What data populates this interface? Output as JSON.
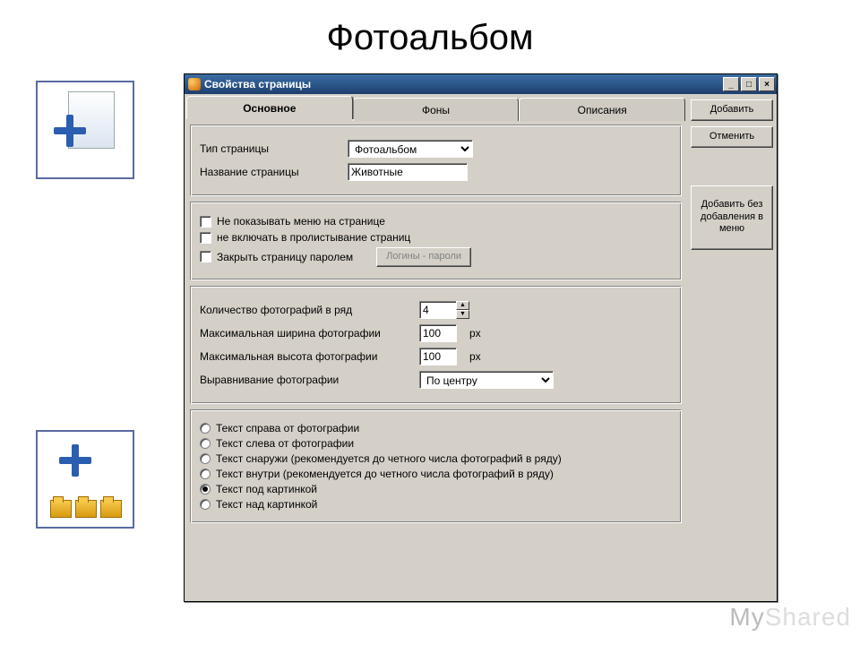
{
  "pageTitle": "Фотоальбом",
  "watermark": {
    "a": "My",
    "b": "Shared"
  },
  "window": {
    "title": "Свойства страницы",
    "tabs": [
      "Основное",
      "Фоны",
      "Описания"
    ],
    "activeTab": 0,
    "sideButtons": {
      "add": "Добавить",
      "cancel": "Отменить",
      "addNoMenu": "Добавить без добавления в меню"
    },
    "basic": {
      "pageTypeLabel": "Тип страницы",
      "pageTypeValue": "Фотоальбом",
      "pageNameLabel": "Название страницы",
      "pageNameValue": "Животные"
    },
    "options": {
      "hideMenu": "Не показывать меню на странице",
      "excludePaging": "не включать в пролистывание страниц",
      "lockPassword": "Закрыть страницу паролем",
      "loginsButton": "Логины - пароли"
    },
    "photo": {
      "perRowLabel": "Количество фотографий в ряд",
      "perRowValue": "4",
      "maxWidthLabel": "Максимальная ширина фотографии",
      "maxWidthValue": "100",
      "maxHeightLabel": "Максимальная высота фотографии",
      "maxHeightValue": "100",
      "pxUnit": "px",
      "alignLabel": "Выравнивание фотографии",
      "alignValue": "По центру"
    },
    "textPos": {
      "options": [
        "Текст справа от фотографии",
        "Текст слева от фотографии",
        "Текст снаружи (рекомендуется до четного числа фотографий в ряду)",
        "Текст внутри (рекомендуется до четного числа фотографий в ряду)",
        "Текст под картинкой",
        "Текст над картинкой"
      ],
      "selected": 4
    }
  }
}
